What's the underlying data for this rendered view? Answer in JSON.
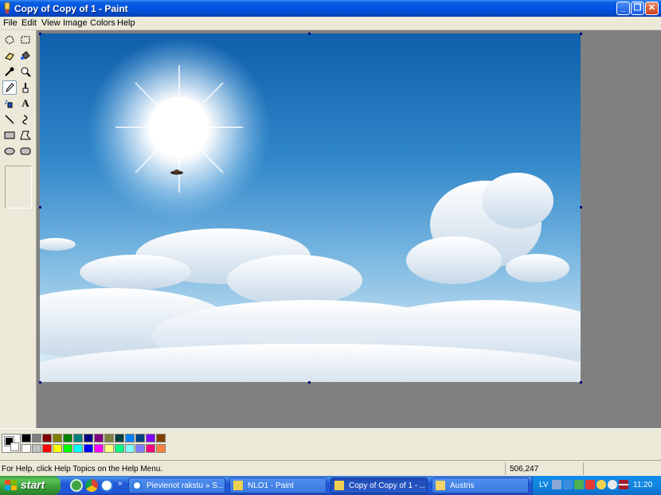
{
  "window": {
    "title": "Copy of Copy of 1 - Paint",
    "buttons": {
      "minimize": "_",
      "maximize": "❐",
      "close": "✕"
    }
  },
  "menu": [
    "File",
    "Edit",
    "View",
    "Image",
    "Colors",
    "Help"
  ],
  "tools": [
    {
      "name": "free-form-select-icon"
    },
    {
      "name": "select-icon"
    },
    {
      "name": "eraser-icon"
    },
    {
      "name": "fill-icon"
    },
    {
      "name": "pick-color-icon"
    },
    {
      "name": "magnifier-icon"
    },
    {
      "name": "pencil-icon",
      "selected": true
    },
    {
      "name": "brush-icon"
    },
    {
      "name": "airbrush-icon"
    },
    {
      "name": "text-icon",
      "glyph": "A"
    },
    {
      "name": "line-icon"
    },
    {
      "name": "curve-icon"
    },
    {
      "name": "rectangle-icon"
    },
    {
      "name": "polygon-icon"
    },
    {
      "name": "ellipse-icon"
    },
    {
      "name": "rounded-rectangle-icon"
    }
  ],
  "palette": {
    "foreground": "#000000",
    "background": "#ffffff",
    "row1": [
      "#000000",
      "#808080",
      "#800000",
      "#808000",
      "#008000",
      "#008080",
      "#000080",
      "#800080",
      "#808040",
      "#004040",
      "#0080ff",
      "#004080",
      "#8000ff",
      "#804000"
    ],
    "row2": [
      "#ffffff",
      "#c0c0c0",
      "#ff0000",
      "#ffff00",
      "#00ff00",
      "#00ffff",
      "#0000ff",
      "#ff00ff",
      "#ffff80",
      "#00ff80",
      "#80ffff",
      "#8080ff",
      "#ff0080",
      "#ff8040"
    ]
  },
  "status": {
    "help": "For Help, click Help Topics on the Help Menu.",
    "coords": "506,247"
  },
  "taskbar": {
    "start": "start",
    "tasks": [
      {
        "label": "Pievienot rakstu » S...",
        "active": false
      },
      {
        "label": "NLO1 - Paint",
        "active": false
      },
      {
        "label": "Copy of Copy of 1 - ...",
        "active": true
      },
      {
        "label": "Austris",
        "active": false
      }
    ],
    "language": "LV",
    "clock": "11:20"
  }
}
